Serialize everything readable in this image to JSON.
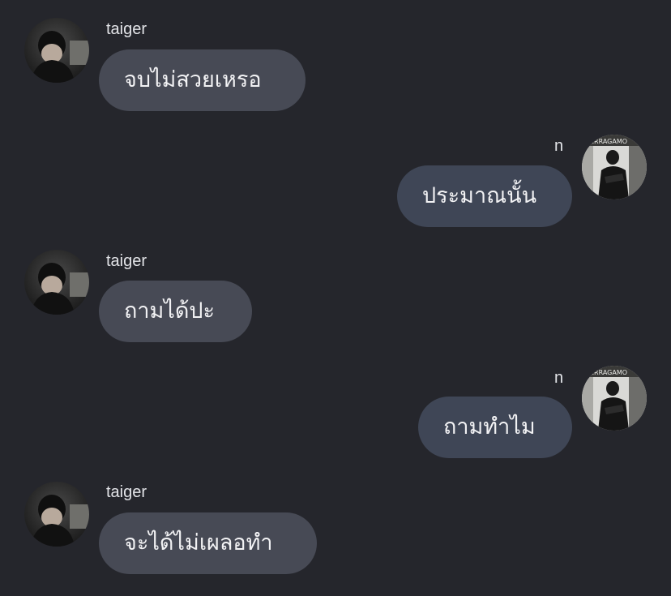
{
  "messages": [
    {
      "sender": "taiger",
      "direction": "incoming",
      "text": "จบไม่สวยเหรอ",
      "avatar": "avatar-taiger"
    },
    {
      "sender": "n",
      "direction": "outgoing",
      "text": "ประมาณนั้น",
      "avatar": "avatar-n"
    },
    {
      "sender": "taiger",
      "direction": "incoming",
      "text": "ถามได้ปะ",
      "avatar": "avatar-taiger"
    },
    {
      "sender": "n",
      "direction": "outgoing",
      "text": "ถามทำไม",
      "avatar": "avatar-n"
    },
    {
      "sender": "taiger",
      "direction": "incoming",
      "text": "จะได้ไม่เผลอทำ",
      "avatar": "avatar-taiger"
    }
  ],
  "colors": {
    "background": "#25262c",
    "incoming_bubble": "#474a55",
    "outgoing_bubble": "#3f4656",
    "text": "#f2f2f4"
  }
}
